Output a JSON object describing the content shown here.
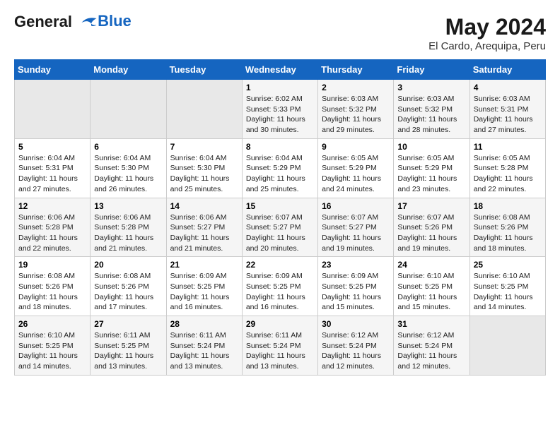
{
  "header": {
    "logo_line1": "General",
    "logo_line2": "Blue",
    "title": "May 2024",
    "subtitle": "El Cardo, Arequipa, Peru"
  },
  "calendar": {
    "days_of_week": [
      "Sunday",
      "Monday",
      "Tuesday",
      "Wednesday",
      "Thursday",
      "Friday",
      "Saturday"
    ],
    "weeks": [
      [
        {
          "day": "",
          "empty": true
        },
        {
          "day": "",
          "empty": true
        },
        {
          "day": "",
          "empty": true
        },
        {
          "day": "1",
          "sunrise": "6:02 AM",
          "sunset": "5:33 PM",
          "daylight": "11 hours and 30 minutes."
        },
        {
          "day": "2",
          "sunrise": "6:03 AM",
          "sunset": "5:32 PM",
          "daylight": "11 hours and 29 minutes."
        },
        {
          "day": "3",
          "sunrise": "6:03 AM",
          "sunset": "5:32 PM",
          "daylight": "11 hours and 28 minutes."
        },
        {
          "day": "4",
          "sunrise": "6:03 AM",
          "sunset": "5:31 PM",
          "daylight": "11 hours and 27 minutes."
        }
      ],
      [
        {
          "day": "5",
          "sunrise": "6:04 AM",
          "sunset": "5:31 PM",
          "daylight": "11 hours and 27 minutes."
        },
        {
          "day": "6",
          "sunrise": "6:04 AM",
          "sunset": "5:30 PM",
          "daylight": "11 hours and 26 minutes."
        },
        {
          "day": "7",
          "sunrise": "6:04 AM",
          "sunset": "5:30 PM",
          "daylight": "11 hours and 25 minutes."
        },
        {
          "day": "8",
          "sunrise": "6:04 AM",
          "sunset": "5:29 PM",
          "daylight": "11 hours and 25 minutes."
        },
        {
          "day": "9",
          "sunrise": "6:05 AM",
          "sunset": "5:29 PM",
          "daylight": "11 hours and 24 minutes."
        },
        {
          "day": "10",
          "sunrise": "6:05 AM",
          "sunset": "5:29 PM",
          "daylight": "11 hours and 23 minutes."
        },
        {
          "day": "11",
          "sunrise": "6:05 AM",
          "sunset": "5:28 PM",
          "daylight": "11 hours and 22 minutes."
        }
      ],
      [
        {
          "day": "12",
          "sunrise": "6:06 AM",
          "sunset": "5:28 PM",
          "daylight": "11 hours and 22 minutes."
        },
        {
          "day": "13",
          "sunrise": "6:06 AM",
          "sunset": "5:28 PM",
          "daylight": "11 hours and 21 minutes."
        },
        {
          "day": "14",
          "sunrise": "6:06 AM",
          "sunset": "5:27 PM",
          "daylight": "11 hours and 21 minutes."
        },
        {
          "day": "15",
          "sunrise": "6:07 AM",
          "sunset": "5:27 PM",
          "daylight": "11 hours and 20 minutes."
        },
        {
          "day": "16",
          "sunrise": "6:07 AM",
          "sunset": "5:27 PM",
          "daylight": "11 hours and 19 minutes."
        },
        {
          "day": "17",
          "sunrise": "6:07 AM",
          "sunset": "5:26 PM",
          "daylight": "11 hours and 19 minutes."
        },
        {
          "day": "18",
          "sunrise": "6:08 AM",
          "sunset": "5:26 PM",
          "daylight": "11 hours and 18 minutes."
        }
      ],
      [
        {
          "day": "19",
          "sunrise": "6:08 AM",
          "sunset": "5:26 PM",
          "daylight": "11 hours and 18 minutes."
        },
        {
          "day": "20",
          "sunrise": "6:08 AM",
          "sunset": "5:26 PM",
          "daylight": "11 hours and 17 minutes."
        },
        {
          "day": "21",
          "sunrise": "6:09 AM",
          "sunset": "5:25 PM",
          "daylight": "11 hours and 16 minutes."
        },
        {
          "day": "22",
          "sunrise": "6:09 AM",
          "sunset": "5:25 PM",
          "daylight": "11 hours and 16 minutes."
        },
        {
          "day": "23",
          "sunrise": "6:09 AM",
          "sunset": "5:25 PM",
          "daylight": "11 hours and 15 minutes."
        },
        {
          "day": "24",
          "sunrise": "6:10 AM",
          "sunset": "5:25 PM",
          "daylight": "11 hours and 15 minutes."
        },
        {
          "day": "25",
          "sunrise": "6:10 AM",
          "sunset": "5:25 PM",
          "daylight": "11 hours and 14 minutes."
        }
      ],
      [
        {
          "day": "26",
          "sunrise": "6:10 AM",
          "sunset": "5:25 PM",
          "daylight": "11 hours and 14 minutes."
        },
        {
          "day": "27",
          "sunrise": "6:11 AM",
          "sunset": "5:25 PM",
          "daylight": "11 hours and 13 minutes."
        },
        {
          "day": "28",
          "sunrise": "6:11 AM",
          "sunset": "5:24 PM",
          "daylight": "11 hours and 13 minutes."
        },
        {
          "day": "29",
          "sunrise": "6:11 AM",
          "sunset": "5:24 PM",
          "daylight": "11 hours and 13 minutes."
        },
        {
          "day": "30",
          "sunrise": "6:12 AM",
          "sunset": "5:24 PM",
          "daylight": "11 hours and 12 minutes."
        },
        {
          "day": "31",
          "sunrise": "6:12 AM",
          "sunset": "5:24 PM",
          "daylight": "11 hours and 12 minutes."
        },
        {
          "day": "",
          "empty": true
        }
      ]
    ]
  }
}
